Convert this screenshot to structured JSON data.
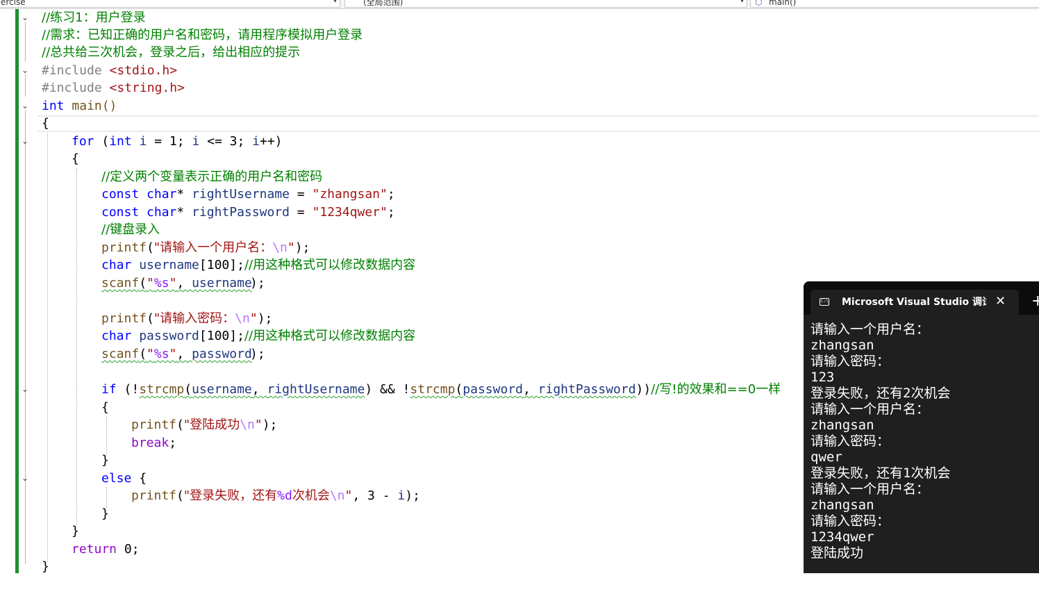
{
  "navbar": {
    "project": "ercise",
    "scope": "(全局范围)",
    "member": "main()"
  },
  "code": {
    "l1": "//练习1：用户登录",
    "l2": "//需求：已知正确的用户名和密码，请用程序模拟用户登录",
    "l3": "//总共给三次机会，登录之后，给出相应的提示",
    "l4_a": "#include ",
    "l4_b": "<stdio.h>",
    "l5_a": "#include ",
    "l5_b": "<string.h>",
    "l6_a": "int",
    "l6_b": " main()",
    "l7": "{",
    "l8_a": "for",
    "l8_b": " (",
    "l8_c": "int",
    "l8_d": " ",
    "l8_e": "i",
    "l8_f": " = 1; ",
    "l8_g": "i",
    "l8_h": " <= 3; ",
    "l8_i": "i",
    "l8_j": "++)",
    "l9": "{",
    "l10": "//定义两个变量表示正确的用户名和密码",
    "l11_a": "const",
    "l11_b": " ",
    "l11_c": "char",
    "l11_d": "* ",
    "l11_e": "rightUsername",
    "l11_f": " = ",
    "l11_g": "\"zhangsan\"",
    "l11_h": ";",
    "l12_a": "const",
    "l12_b": " ",
    "l12_c": "char",
    "l12_d": "* ",
    "l12_e": "rightPassword",
    "l12_f": " = ",
    "l12_g": "\"1234qwer\"",
    "l12_h": ";",
    "l13": "//键盘录入",
    "l14_a": "printf",
    "l14_b": "(",
    "l14_c": "\"请输入一个用户名：",
    "l14_d": "\\n",
    "l14_e": "\"",
    "l14_f": ");",
    "l15_a": "char",
    "l15_b": " ",
    "l15_c": "username",
    "l15_d": "[100];",
    "l15_e": "//用这种格式可以修改数据内容",
    "l16_a": "scanf",
    "l16_b": "(",
    "l16_c": "\"",
    "l16_d": "%s",
    "l16_e": "\"",
    "l16_f": ", ",
    "l16_g": "username",
    "l16_h": ");",
    "l18_a": "printf",
    "l18_b": "(",
    "l18_c": "\"请输入密码：",
    "l18_d": "\\n",
    "l18_e": "\"",
    "l18_f": ");",
    "l19_a": "char",
    "l19_b": " ",
    "l19_c": "password",
    "l19_d": "[100];",
    "l19_e": "//用这种格式可以修改数据内容",
    "l20_a": "scanf",
    "l20_b": "(",
    "l20_c": "\"",
    "l20_d": "%s",
    "l20_e": "\"",
    "l20_f": ", ",
    "l20_g": "password",
    "l20_h": ");",
    "l22_a": "if",
    "l22_b": " (!",
    "l22_c": "strcmp",
    "l22_d": "(",
    "l22_e": "username",
    "l22_f": ", ",
    "l22_g": "rightUsername",
    "l22_h": ") && !",
    "l22_i": "strcmp",
    "l22_j": "(",
    "l22_k": "password",
    "l22_l": ", ",
    "l22_m": "rightPassword",
    "l22_n": "))",
    "l22_o": "//写!的效果和==0一样",
    "l23": "{",
    "l24_a": "printf",
    "l24_b": "(",
    "l24_c": "\"登陆成功",
    "l24_d": "\\n",
    "l24_e": "\"",
    "l24_f": ");",
    "l25_a": "break",
    "l25_b": ";",
    "l26": "}",
    "l27_a": "else",
    "l27_b": " {",
    "l28_a": "printf",
    "l28_b": "(",
    "l28_c": "\"登录失败，还有",
    "l28_d": "%d",
    "l28_e": "次机会",
    "l28_f": "\\n",
    "l28_g": "\"",
    "l28_h": ", 3 - ",
    "l28_i": "i",
    "l28_j": ");",
    "l29": "}",
    "l30": "}",
    "l31_a": "return",
    "l31_b": " 0;",
    "l32": "}"
  },
  "console": {
    "tab_title": "Microsoft Visual Studio 调试控制台",
    "icon_text": "C:\\",
    "close_label": "✕",
    "new_tab_label": "+",
    "lines": [
      "请输入一个用户名：",
      "zhangsan",
      "请输入密码：",
      "123",
      "登录失败，还有2次机会",
      "请输入一个用户名：",
      "zhangsan",
      "请输入密码：",
      "qwer",
      "登录失败，还有1次机会",
      "请输入一个用户名：",
      "zhangsan",
      "请输入密码：",
      "1234qwer",
      "登陆成功"
    ]
  },
  "colors": {
    "keyword": "#0000ff",
    "comment": "#008000",
    "string": "#a31515",
    "function": "#74531f",
    "variable": "#1f377f",
    "escape": "#b776fb",
    "change_bar": "#1f8f2f",
    "console_bg": "#1f1f1f"
  }
}
